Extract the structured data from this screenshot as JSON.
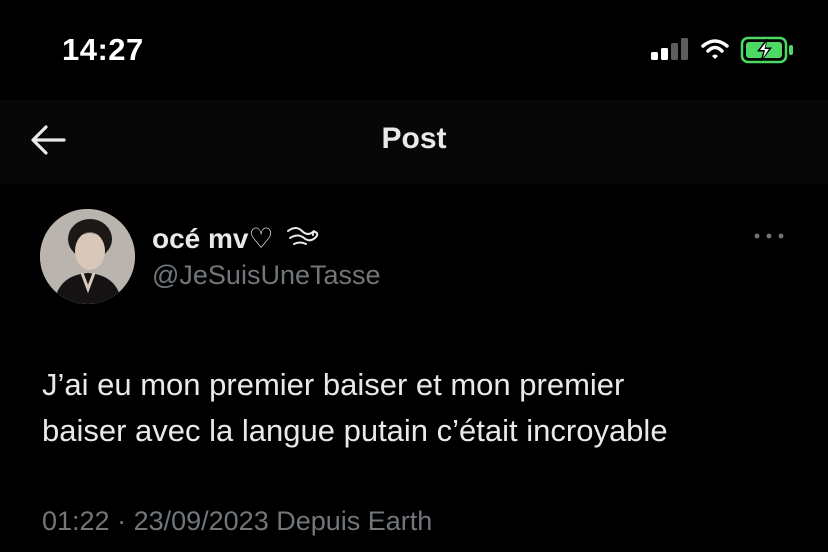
{
  "status_bar": {
    "time": "14:27",
    "icons": [
      "cellular-signal-icon",
      "wifi-icon",
      "battery-charging-icon"
    ],
    "battery_color": "#4cd964"
  },
  "header": {
    "back_icon": "arrow-left-icon",
    "title": "Post"
  },
  "post": {
    "display_name": "océ mv♡",
    "handle": "@JeSuisUneTasse",
    "text_line_1": "J’ai eu mon premier baiser et mon premier",
    "text_line_2": "baiser avec la langue putain c’était incroyable",
    "time": "01:22",
    "separator": " · ",
    "date": "23/09/2023",
    "source": " Depuis Earth",
    "more_icon": "more-horizontal-icon"
  },
  "colors": {
    "background": "#000000",
    "header_background": "#070707",
    "primary_text": "#e7e9ea",
    "secondary_text": "#71767b"
  }
}
